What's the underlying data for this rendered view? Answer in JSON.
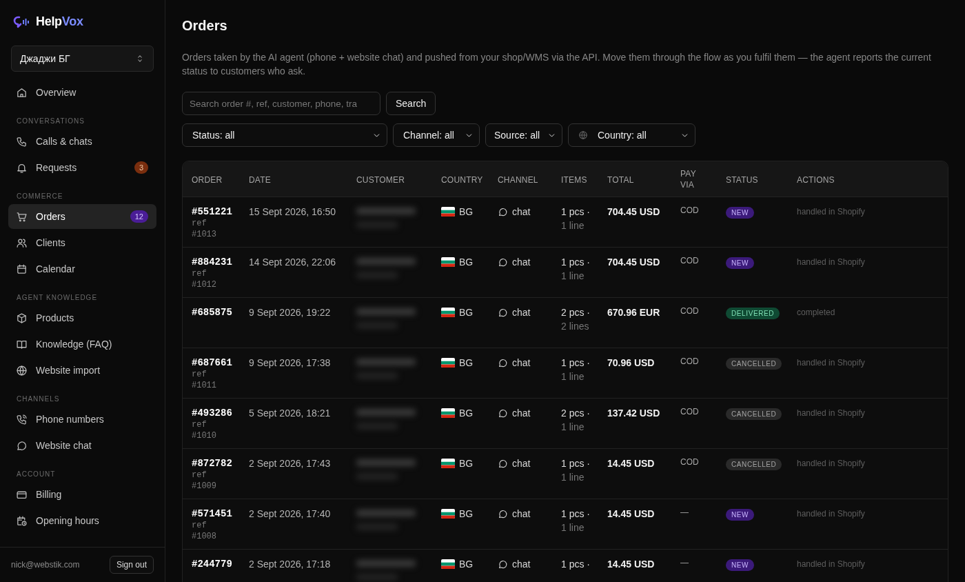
{
  "brand": {
    "name_start": "Help",
    "name_end": "Vox"
  },
  "workspace": {
    "label": "Джаджи БГ"
  },
  "sidebar": {
    "sections": [
      {
        "items": [
          {
            "label": "Overview",
            "selected": false
          }
        ]
      },
      {
        "heading": "CONVERSATIONS",
        "items": [
          {
            "label": "Calls & chats",
            "selected": false
          },
          {
            "label": "Requests",
            "selected": false,
            "badge": {
              "text": "3",
              "color": "#7a2e0e"
            }
          }
        ]
      },
      {
        "heading": "COMMERCE",
        "items": [
          {
            "label": "Orders",
            "selected": true,
            "badge": {
              "text": "12",
              "color": "#4a1d96"
            }
          },
          {
            "label": "Clients",
            "selected": false
          },
          {
            "label": "Calendar",
            "selected": false
          }
        ]
      },
      {
        "heading": "AGENT KNOWLEDGE",
        "items": [
          {
            "label": "Products",
            "selected": false
          },
          {
            "label": "Knowledge (FAQ)",
            "selected": false
          },
          {
            "label": "Website import",
            "selected": false
          }
        ]
      },
      {
        "heading": "CHANNELS",
        "items": [
          {
            "label": "Phone numbers",
            "selected": false
          },
          {
            "label": "Website chat",
            "selected": false
          }
        ]
      },
      {
        "heading": "ACCOUNT",
        "items": [
          {
            "label": "Billing",
            "selected": false
          },
          {
            "label": "Opening hours",
            "selected": false
          }
        ]
      }
    ]
  },
  "user": {
    "email": "nick@webstik.com",
    "sign_out": "Sign out"
  },
  "page": {
    "title": "Orders",
    "description": "Orders taken by the AI agent (phone + website chat) and pushed from your shop/WMS via the API. Move them through the flow as you fulfil them — the agent reports the current status to customers who ask."
  },
  "search": {
    "placeholder": "Search order #, ref, customer, phone, tra",
    "button": "Search"
  },
  "filters": [
    {
      "label": "Status: all"
    },
    {
      "label": "Channel: all"
    },
    {
      "label": "Source: all"
    },
    {
      "label": "Country: all",
      "globe": true
    }
  ],
  "table": {
    "columns": [
      "ORDER",
      "DATE",
      "CUSTOMER",
      "COUNTRY",
      "CHANNEL",
      "ITEMS",
      "TOTAL",
      "PAY VIA",
      "STATUS",
      "ACTIONS"
    ],
    "rows": [
      {
        "order": "#551221",
        "ref_label": "ref",
        "ref": "#1013",
        "date": "15 Sept 2026, 16:50",
        "customer": {
          "kind": "blurred"
        },
        "country": "BG",
        "channel": "chat",
        "pcs": "1 pcs ·",
        "lines": "1 line",
        "total": "704.45 USD",
        "pay_via": "COD",
        "status": {
          "label": "NEW",
          "kind": "new"
        },
        "action": "handled in Shopify"
      },
      {
        "order": "#884231",
        "ref_label": "ref",
        "ref": "#1012",
        "date": "14 Sept 2026, 22:06",
        "customer": {
          "kind": "blurred"
        },
        "country": "BG",
        "channel": "chat",
        "pcs": "1 pcs ·",
        "lines": "1 line",
        "total": "704.45 USD",
        "pay_via": "COD",
        "status": {
          "label": "NEW",
          "kind": "new"
        },
        "action": "handled in Shopify"
      },
      {
        "order": "#685875",
        "date": "9 Sept 2026, 19:22",
        "customer": {
          "kind": "blurred"
        },
        "country": "BG",
        "channel": "chat",
        "pcs": "2 pcs ·",
        "lines": "2 lines",
        "total": "670.96 EUR",
        "pay_via": "COD",
        "status": {
          "label": "DELIVERED",
          "kind": "delivered"
        },
        "action": "completed"
      },
      {
        "order": "#687661",
        "ref_label": "ref",
        "ref": "#1011",
        "date": "9 Sept 2026, 17:38",
        "customer": {
          "kind": "blurred"
        },
        "country": "BG",
        "channel": "chat",
        "pcs": "1 pcs ·",
        "lines": "1 line",
        "total": "70.96 USD",
        "pay_via": "COD",
        "status": {
          "label": "CANCELLED",
          "kind": "cancelled"
        },
        "action": "handled in Shopify"
      },
      {
        "order": "#493286",
        "ref_label": "ref",
        "ref": "#1010",
        "date": "5 Sept 2026, 18:21",
        "customer": {
          "kind": "blurred"
        },
        "country": "BG",
        "channel": "chat",
        "pcs": "2 pcs ·",
        "lines": "1 line",
        "total": "137.42 USD",
        "pay_via": "COD",
        "status": {
          "label": "CANCELLED",
          "kind": "cancelled"
        },
        "action": "handled in Shopify"
      },
      {
        "order": "#872782",
        "ref_label": "ref",
        "ref": "#1009",
        "date": "2 Sept 2026, 17:43",
        "customer": {
          "kind": "blurred"
        },
        "country": "BG",
        "channel": "chat",
        "pcs": "1 pcs ·",
        "lines": "1 line",
        "total": "14.45 USD",
        "pay_via": "COD",
        "status": {
          "label": "CANCELLED",
          "kind": "cancelled"
        },
        "action": "handled in Shopify"
      },
      {
        "order": "#571451",
        "ref_label": "ref",
        "ref": "#1008",
        "date": "2 Sept 2026, 17:40",
        "customer": {
          "kind": "blurred"
        },
        "country": "BG",
        "channel": "chat",
        "pcs": "1 pcs ·",
        "lines": "1 line",
        "total": "14.45 USD",
        "pay_via": "—",
        "status": {
          "label": "NEW",
          "kind": "new"
        },
        "action": "handled in Shopify"
      },
      {
        "order": "#244779",
        "date": "2 Sept 2026, 17:18",
        "customer": {
          "kind": "blurred"
        },
        "country": "BG",
        "channel": "chat",
        "pcs": "1 pcs ·",
        "total": "14.45 USD",
        "pay_via": "—",
        "status": {
          "label": "NEW",
          "kind": "new"
        },
        "action": "handled in Shopify"
      }
    ]
  }
}
